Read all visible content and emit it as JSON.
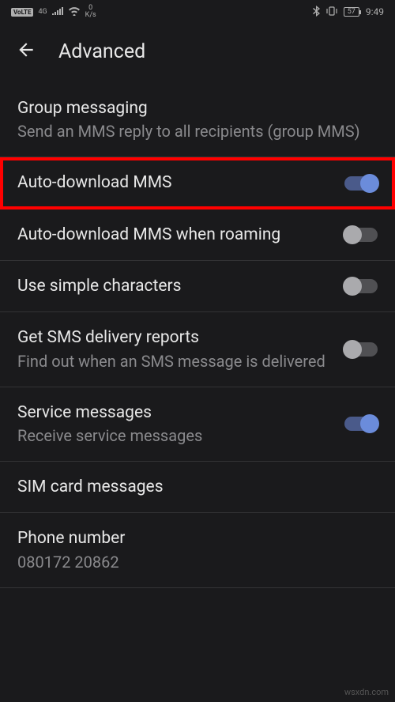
{
  "statusBar": {
    "volte": "VoLTE",
    "network": "4G",
    "speedValue": "0",
    "speedUnit": "K/s",
    "battery": "57",
    "time": "9:49"
  },
  "header": {
    "title": "Advanced"
  },
  "settings": [
    {
      "title": "Group messaging",
      "subtitle": "Send an MMS reply to all recipients (group MMS)",
      "hasToggle": false,
      "highlighted": false
    },
    {
      "title": "Auto-download MMS",
      "subtitle": "",
      "hasToggle": true,
      "toggleOn": true,
      "highlighted": true
    },
    {
      "title": "Auto-download MMS when roaming",
      "subtitle": "",
      "hasToggle": true,
      "toggleOn": false,
      "highlighted": false
    },
    {
      "title": "Use simple characters",
      "subtitle": "",
      "hasToggle": true,
      "toggleOn": false,
      "highlighted": false
    },
    {
      "title": "Get SMS delivery reports",
      "subtitle": "Find out when an SMS message is delivered",
      "hasToggle": true,
      "toggleOn": false,
      "highlighted": false
    },
    {
      "title": "Service messages",
      "subtitle": "Receive service messages",
      "hasToggle": true,
      "toggleOn": true,
      "highlighted": false
    },
    {
      "title": "SIM card messages",
      "subtitle": "",
      "hasToggle": false,
      "highlighted": false
    },
    {
      "title": "Phone number",
      "subtitle": "080172 20862",
      "hasToggle": false,
      "highlighted": false
    }
  ],
  "watermark": "wsxdn.com"
}
